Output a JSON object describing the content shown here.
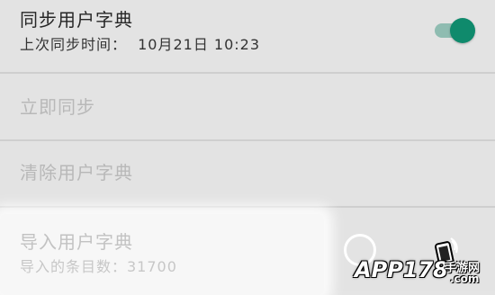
{
  "settings": {
    "sync_dictionary": {
      "title": "同步用户字典",
      "subtitle_label": "上次同步时间：",
      "subtitle_value": "10月21日 10:23",
      "toggle_on": true
    },
    "sync_now": {
      "title": "立即同步"
    },
    "clear_dictionary": {
      "title": "清除用户字典"
    },
    "import_dictionary": {
      "title": "导入用户字典",
      "subtitle": "导入的条目数：31700"
    }
  },
  "watermark": {
    "brand": "APP178",
    "chinese": "手游网",
    "domain": ".com"
  },
  "colors": {
    "background": "#e3e3e3",
    "toggle_thumb": "#0f8a6c",
    "toggle_track": "#8fbcb1",
    "text_primary": "#262626",
    "text_disabled": "#b8b8b8"
  }
}
